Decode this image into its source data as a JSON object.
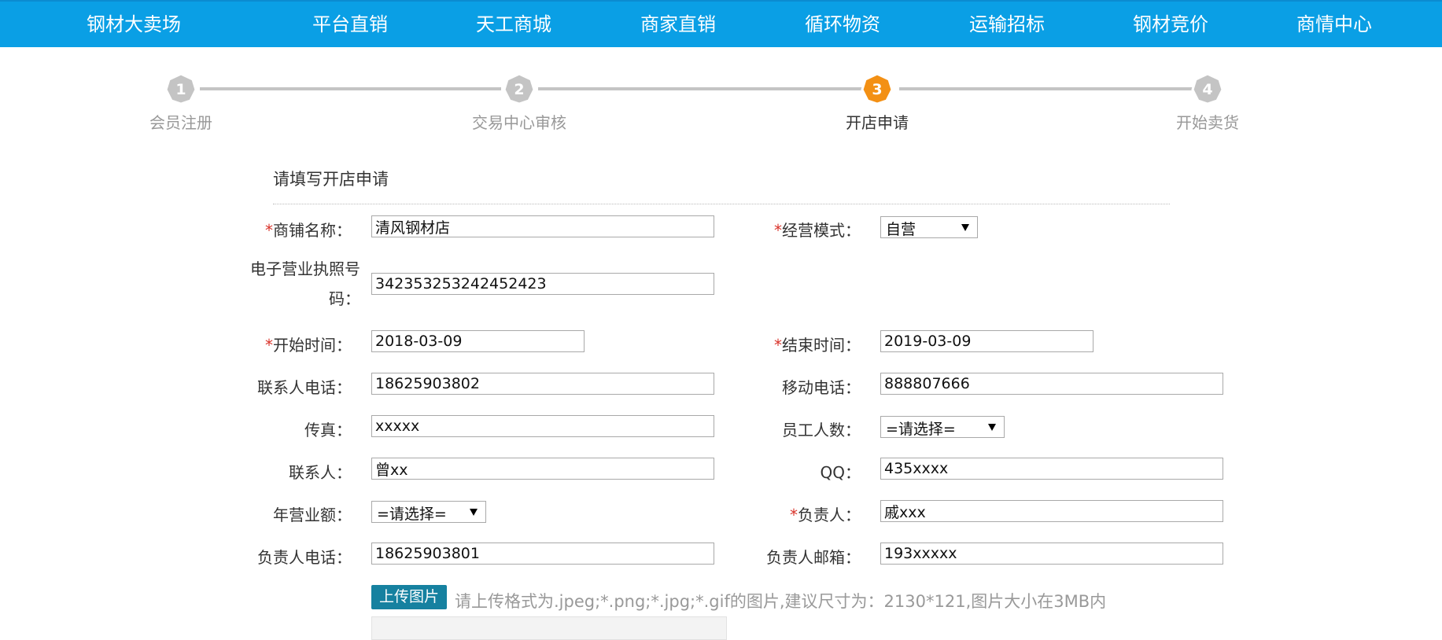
{
  "nav": [
    "钢材大卖场",
    "平台直销",
    "天工商城",
    "商家直销",
    "循环物资",
    "运输招标",
    "钢材竞价",
    "商情中心"
  ],
  "steps": [
    {
      "number": "1",
      "label": "会员注册",
      "state": "done"
    },
    {
      "number": "2",
      "label": "交易中心审核",
      "state": "done"
    },
    {
      "number": "3",
      "label": "开店申请",
      "state": "active"
    },
    {
      "number": "4",
      "label": "开始卖货",
      "state": "pending"
    }
  ],
  "colors": {
    "nav_bg": "#0a9fe5",
    "active_step": "#f39014",
    "inactive_step": "#c4c4c4",
    "required": "#d9342b",
    "upload_btn": "#1681a0"
  },
  "form": {
    "title": "请填写开店申请",
    "required_mark": "*",
    "shop_name": {
      "label": "商铺名称：",
      "value": "清风钢材店"
    },
    "business_mode": {
      "label": "经营模式：",
      "value": "自营"
    },
    "license_no": {
      "label_line1": "电子营业执照号",
      "label_line2": "码：",
      "value": "342353253242452423"
    },
    "start_time": {
      "label": "开始时间：",
      "value": "2018-03-09"
    },
    "end_time": {
      "label": "结束时间：",
      "value": "2019-03-09"
    },
    "contact_phone": {
      "label": "联系人电话：",
      "value": "18625903802"
    },
    "mobile": {
      "label": "移动电话：",
      "value": "888807666"
    },
    "fax": {
      "label": "传真：",
      "value": "xxxxx"
    },
    "staff_count": {
      "label": "员工人数：",
      "value": "=请选择="
    },
    "contact": {
      "label": "联系人：",
      "value": "曾xx"
    },
    "qq": {
      "label": "QQ：",
      "value": "435xxxx"
    },
    "annual_revenue": {
      "label": "年营业额：",
      "value": "=请选择="
    },
    "manager": {
      "label": "负责人：",
      "value": "戚xxx"
    },
    "manager_phone": {
      "label": "负责人电话：",
      "value": "18625903801"
    },
    "manager_email": {
      "label": "负责人邮箱：",
      "value": "193xxxxx"
    },
    "upload_label": "上传图片",
    "upload_hint": "请上传格式为.jpeg;*.png;*.jpg;*.gif的图片,建议尺寸为：2130*121,图片大小在3MB内"
  }
}
